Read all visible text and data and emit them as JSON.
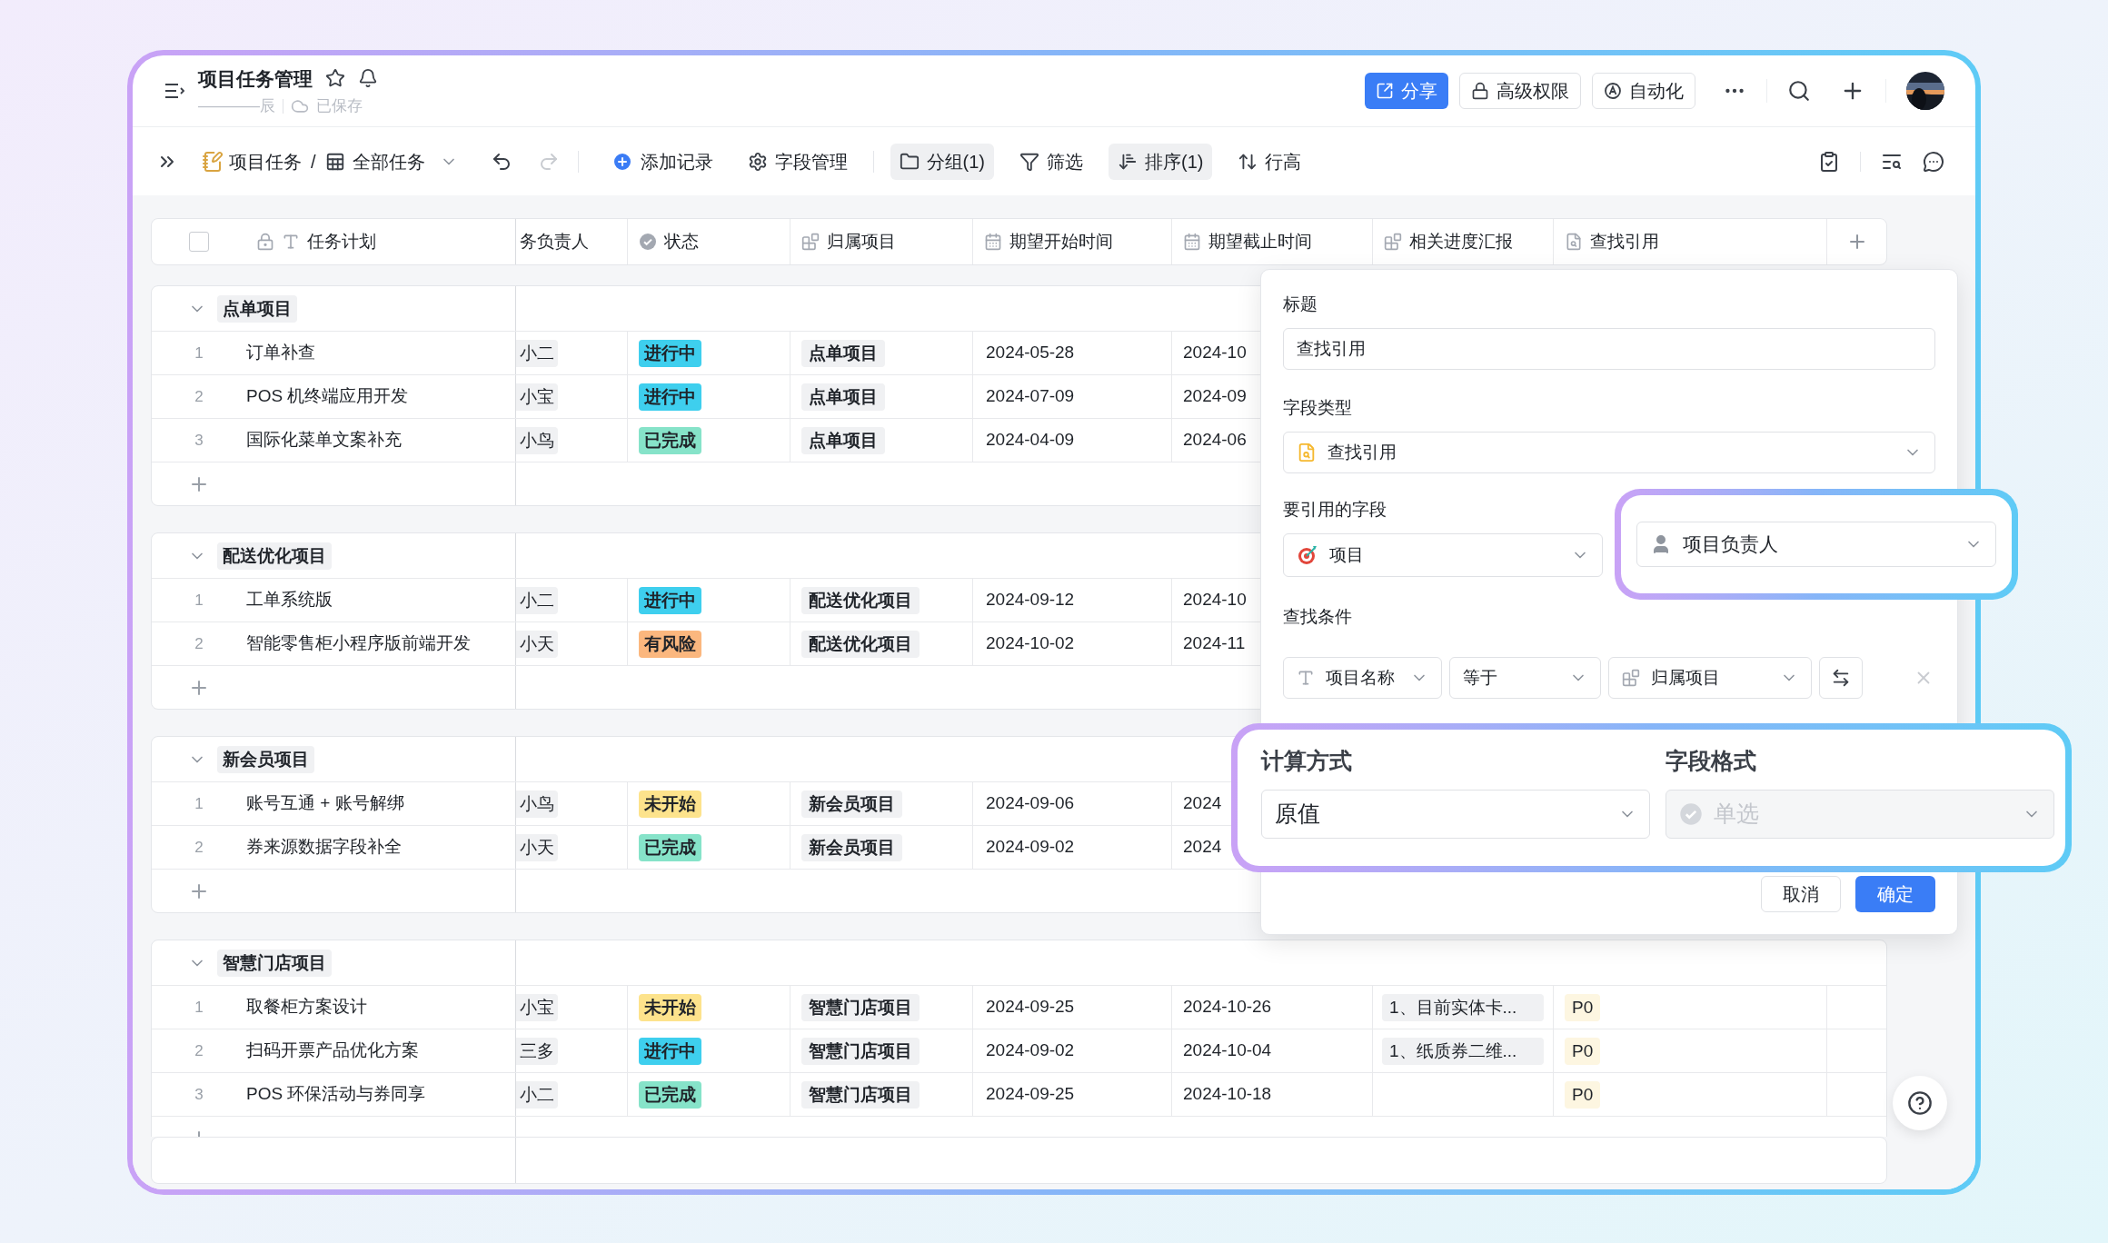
{
  "header": {
    "title": "项目任务管理",
    "starred": false,
    "owner": "————辰",
    "save_status": "已保存",
    "buttons": [
      {
        "label": "分享",
        "kind": "primary"
      },
      {
        "label": "高级权限",
        "kind": "lock"
      },
      {
        "label": "自动化",
        "kind": "auto"
      }
    ]
  },
  "toolbar": {
    "base": "项目任务",
    "separator": "/",
    "view": "全部任务",
    "undo_disabled": false,
    "redo_disabled": true,
    "actions": [
      {
        "label": "添加记录",
        "kind": "add",
        "active": false
      },
      {
        "label": "字段管理",
        "kind": "fields",
        "active": false
      },
      {
        "label": "分组(1)",
        "kind": "group",
        "active": true
      },
      {
        "label": "筛选",
        "kind": "filter",
        "active": false
      },
      {
        "label": "排序(1)",
        "kind": "sort",
        "active": true
      },
      {
        "label": "行高",
        "kind": "height",
        "active": false
      }
    ]
  },
  "table": {
    "select_all": {
      "checked": false
    },
    "columns": [
      {
        "label": "任务计划",
        "kind": "text"
      },
      {
        "label": "务负责人",
        "kind": "person"
      },
      {
        "label": "状态",
        "kind": "status"
      },
      {
        "label": "归属项目",
        "kind": "link"
      },
      {
        "label": "期望开始时间",
        "kind": "date"
      },
      {
        "label": "期望截止时间",
        "kind": "date"
      },
      {
        "label": "相关进度汇报",
        "kind": "link"
      },
      {
        "label": "查找引用",
        "kind": "lookup"
      }
    ],
    "groups": [
      {
        "label": "点单项目",
        "expanded": true,
        "rows": [
          {
            "index": "1",
            "name": "订单补查",
            "owner": "小二",
            "status": {
              "label": "进行中",
              "color": "#3ecfee"
            },
            "project": "点单项目",
            "start": "2024-05-28",
            "end": "2024-10"
          },
          {
            "index": "2",
            "name": "POS 机终端应用开发",
            "owner": "小宝",
            "status": {
              "label": "进行中",
              "color": "#3ecfee"
            },
            "project": "点单项目",
            "start": "2024-07-09",
            "end": "2024-09"
          },
          {
            "index": "3",
            "name": "国际化菜单文案补充",
            "owner": "小鸟",
            "status": {
              "label": "已完成",
              "color": "#86e3c9"
            },
            "project": "点单项目",
            "start": "2024-04-09",
            "end": "2024-06"
          }
        ]
      },
      {
        "label": "配送优化项目",
        "expanded": true,
        "rows": [
          {
            "index": "1",
            "name": "工单系统版",
            "owner": "小二",
            "status": {
              "label": "进行中",
              "color": "#3ecfee"
            },
            "project": "配送优化项目",
            "start": "2024-09-12",
            "end": "2024-10"
          },
          {
            "index": "2",
            "name": "智能零售柜小程序版前端开发",
            "owner": "小天",
            "status": {
              "label": "有风险",
              "color": "#fbb77e"
            },
            "project": "配送优化项目",
            "start": "2024-10-02",
            "end": "2024-11"
          }
        ]
      },
      {
        "label": "新会员项目",
        "expanded": true,
        "rows": [
          {
            "index": "1",
            "name": "账号互通 + 账号解绑",
            "owner": "小鸟",
            "status": {
              "label": "未开始",
              "color": "#fde38c"
            },
            "project": "新会员项目",
            "start": "2024-09-06",
            "end": "2024"
          },
          {
            "index": "2",
            "name": "券来源数据字段补全",
            "owner": "小天",
            "status": {
              "label": "已完成",
              "color": "#86e3c9"
            },
            "project": "新会员项目",
            "start": "2024-09-02",
            "end": "2024"
          }
        ]
      },
      {
        "label": "智慧门店项目",
        "expanded": true,
        "rows": [
          {
            "index": "1",
            "name": "取餐柜方案设计",
            "owner": "小宝",
            "status": {
              "label": "未开始",
              "color": "#fde38c"
            },
            "project": "智慧门店项目",
            "start": "2024-09-25",
            "end": "2024-10-26",
            "progress": "1、目前实体卡...",
            "lookup": "P0"
          },
          {
            "index": "2",
            "name": "扫码开票产品优化方案",
            "owner": "三多",
            "status": {
              "label": "进行中",
              "color": "#3ecfee"
            },
            "project": "智慧门店项目",
            "start": "2024-09-02",
            "end": "2024-10-04",
            "progress": "1、纸质券二维...",
            "lookup": "P0"
          },
          {
            "index": "3",
            "name": "POS 环保活动与券同享",
            "owner": "小二",
            "status": {
              "label": "已完成",
              "color": "#86e3c9"
            },
            "project": "智慧门店项目",
            "start": "2024-09-25",
            "end": "2024-10-18",
            "lookup": "P0"
          }
        ]
      }
    ]
  },
  "field_panel": {
    "title_label": "标题",
    "title_value": "查找引用",
    "type_label": "字段类型",
    "type_value": "查找引用",
    "ref_label": "要引用的字段",
    "ref_table": "项目",
    "ref_field": "项目负责人",
    "condition_label": "查找条件",
    "condition": {
      "field": "项目名称",
      "operator": "等于",
      "value": "归属项目"
    },
    "calc_label": "计算方式",
    "calc_value": "原值",
    "format_label": "字段格式",
    "format_value": "单选",
    "format_disabled": true,
    "buttons": [
      {
        "label": "取消",
        "kind": "secondary"
      },
      {
        "label": "确定",
        "kind": "primary"
      }
    ]
  }
}
